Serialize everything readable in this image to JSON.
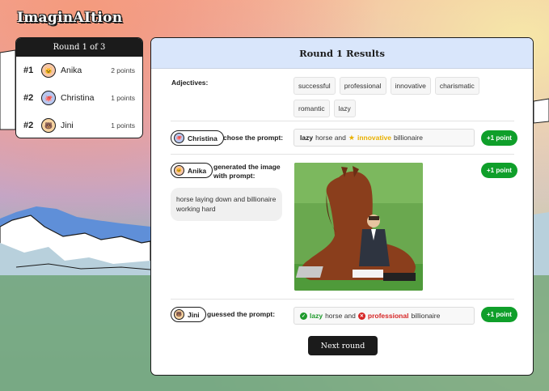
{
  "app": {
    "title": "ImaginAItion"
  },
  "leaderboard": {
    "header": "Round 1 of 3",
    "players": [
      {
        "rank": "#1",
        "name": "Anika",
        "points": "2 points",
        "avatar": "🐱",
        "avatar_color": "#f7c6a8"
      },
      {
        "rank": "#2",
        "name": "Christina",
        "points": "1 points",
        "avatar": "🐙",
        "avatar_color": "#b8c8f0"
      },
      {
        "rank": "#2",
        "name": "Jini",
        "points": "1 points",
        "avatar": "🐻",
        "avatar_color": "#f6d3a0"
      }
    ]
  },
  "results": {
    "title": "Round 1 Results",
    "adjectives_label": "Adjectives:",
    "adjectives": [
      "successful",
      "professional",
      "innovative",
      "charismatic",
      "romantic",
      "lazy"
    ],
    "chose": {
      "user": "Christina",
      "action": "chose the prompt:",
      "words": [
        "lazy",
        "horse and",
        "innovative",
        "billionaire"
      ],
      "award": "+1 point"
    },
    "generated": {
      "user": "Anika",
      "action": "generated the image with prompt:",
      "prompt": "horse laying down and billionaire working hard",
      "award": "+1 point"
    },
    "guessed": {
      "user": "Jini",
      "action": "guessed the prompt:",
      "words": [
        "lazy",
        "horse and",
        "professional",
        "billionaire"
      ],
      "award": "+1 point"
    },
    "next_button": "Next round"
  },
  "colors": {
    "accent_green": "#0f9f2a",
    "header_blue": "#d9e6fb",
    "dark": "#1b1b1b",
    "star": "#e8b000",
    "wrong": "#d62626"
  }
}
